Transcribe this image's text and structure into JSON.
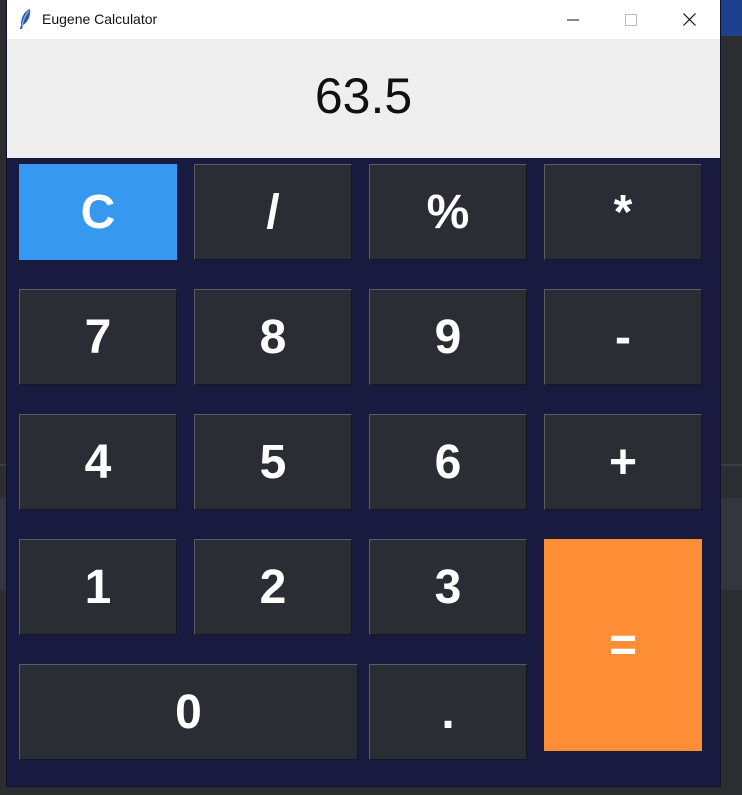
{
  "window": {
    "title": "Eugene Calculator"
  },
  "display": {
    "value": "63.5"
  },
  "keys": {
    "clear": "C",
    "divide": "/",
    "percent": "%",
    "multiply": "*",
    "seven": "7",
    "eight": "8",
    "nine": "9",
    "minus": "-",
    "four": "4",
    "five": "5",
    "six": "6",
    "plus": "+",
    "one": "1",
    "two": "2",
    "three": "3",
    "equals": "=",
    "zero": "0",
    "decimal": "."
  },
  "colors": {
    "keypad_background": "#191a3f",
    "key_background": "#2b2d34",
    "clear_key": "#3798f0",
    "equals_key": "#fd8e36",
    "display_background": "#efefef"
  },
  "icons": {
    "app": "feather-icon",
    "minimize": "minimize-icon",
    "maximize": "maximize-icon",
    "close": "close-icon"
  }
}
